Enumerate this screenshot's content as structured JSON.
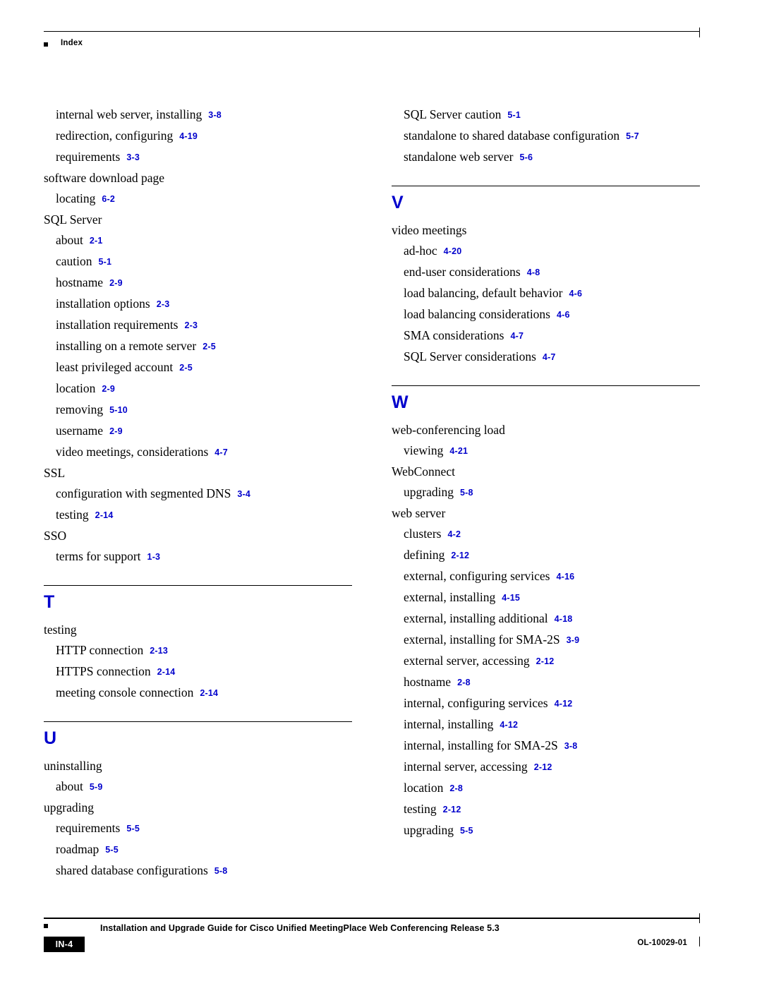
{
  "header": {
    "title": "Index"
  },
  "footer": {
    "page_label": "IN-4",
    "title": "Installation and Upgrade Guide for Cisco Unified MeetingPlace Web Conferencing Release 5.3",
    "doc_id": "OL-10029-01"
  },
  "colors": {
    "page_ref": "#0000cc",
    "letter_heading": "#0000cc",
    "text": "#000000",
    "background": "#ffffff"
  },
  "left_column": [
    {
      "kind": "entry",
      "level": 2,
      "text": "internal web server, installing",
      "page": "3-8"
    },
    {
      "kind": "entry",
      "level": 2,
      "text": "redirection, configuring",
      "page": "4-19"
    },
    {
      "kind": "entry",
      "level": 2,
      "text": "requirements",
      "page": "3-3"
    },
    {
      "kind": "entry",
      "level": 1,
      "text": "software download page",
      "page": ""
    },
    {
      "kind": "entry",
      "level": 2,
      "text": "locating",
      "page": "6-2"
    },
    {
      "kind": "entry",
      "level": 1,
      "text": "SQL Server",
      "page": ""
    },
    {
      "kind": "entry",
      "level": 2,
      "text": "about",
      "page": "2-1"
    },
    {
      "kind": "entry",
      "level": 2,
      "text": "caution",
      "page": "5-1"
    },
    {
      "kind": "entry",
      "level": 2,
      "text": "hostname",
      "page": "2-9"
    },
    {
      "kind": "entry",
      "level": 2,
      "text": "installation options",
      "page": "2-3"
    },
    {
      "kind": "entry",
      "level": 2,
      "text": "installation requirements",
      "page": "2-3"
    },
    {
      "kind": "entry",
      "level": 2,
      "text": "installing on a remote server",
      "page": "2-5"
    },
    {
      "kind": "entry",
      "level": 2,
      "text": "least privileged account",
      "page": "2-5"
    },
    {
      "kind": "entry",
      "level": 2,
      "text": "location",
      "page": "2-9"
    },
    {
      "kind": "entry",
      "level": 2,
      "text": "removing",
      "page": "5-10"
    },
    {
      "kind": "entry",
      "level": 2,
      "text": "username",
      "page": "2-9"
    },
    {
      "kind": "entry",
      "level": 2,
      "text": "video meetings, considerations",
      "page": "4-7"
    },
    {
      "kind": "entry",
      "level": 1,
      "text": "SSL",
      "page": ""
    },
    {
      "kind": "entry",
      "level": 2,
      "text": "configuration with segmented DNS",
      "page": "3-4"
    },
    {
      "kind": "entry",
      "level": 2,
      "text": "testing",
      "page": "2-14"
    },
    {
      "kind": "entry",
      "level": 1,
      "text": "SSO",
      "page": ""
    },
    {
      "kind": "entry",
      "level": 2,
      "text": "terms for support",
      "page": "1-3"
    },
    {
      "kind": "letter",
      "letter": "T"
    },
    {
      "kind": "entry",
      "level": 1,
      "text": "testing",
      "page": ""
    },
    {
      "kind": "entry",
      "level": 2,
      "text": "HTTP connection",
      "page": "2-13"
    },
    {
      "kind": "entry",
      "level": 2,
      "text": "HTTPS connection",
      "page": "2-14"
    },
    {
      "kind": "entry",
      "level": 2,
      "text": "meeting console connection",
      "page": "2-14"
    },
    {
      "kind": "letter",
      "letter": "U"
    },
    {
      "kind": "entry",
      "level": 1,
      "text": "uninstalling",
      "page": ""
    },
    {
      "kind": "entry",
      "level": 2,
      "text": "about",
      "page": "5-9"
    },
    {
      "kind": "entry",
      "level": 1,
      "text": "upgrading",
      "page": ""
    },
    {
      "kind": "entry",
      "level": 2,
      "text": "requirements",
      "page": "5-5"
    },
    {
      "kind": "entry",
      "level": 2,
      "text": "roadmap",
      "page": "5-5"
    },
    {
      "kind": "entry",
      "level": 2,
      "text": "shared database configurations",
      "page": "5-8"
    }
  ],
  "right_column": [
    {
      "kind": "entry",
      "level": 2,
      "text": "SQL Server caution",
      "page": "5-1"
    },
    {
      "kind": "entry",
      "level": 2,
      "text": "standalone to shared database configuration",
      "page": "5-7"
    },
    {
      "kind": "entry",
      "level": 2,
      "text": "standalone web server",
      "page": "5-6"
    },
    {
      "kind": "letter",
      "letter": "V"
    },
    {
      "kind": "entry",
      "level": 1,
      "text": "video meetings",
      "page": ""
    },
    {
      "kind": "entry",
      "level": 2,
      "text": "ad-hoc",
      "page": "4-20"
    },
    {
      "kind": "entry",
      "level": 2,
      "text": "end-user considerations",
      "page": "4-8"
    },
    {
      "kind": "entry",
      "level": 2,
      "text": "load balancing, default behavior",
      "page": "4-6"
    },
    {
      "kind": "entry",
      "level": 2,
      "text": "load balancing considerations",
      "page": "4-6"
    },
    {
      "kind": "entry",
      "level": 2,
      "text": "SMA considerations",
      "page": "4-7"
    },
    {
      "kind": "entry",
      "level": 2,
      "text": "SQL Server considerations",
      "page": "4-7"
    },
    {
      "kind": "letter",
      "letter": "W"
    },
    {
      "kind": "entry",
      "level": 1,
      "text": "web-conferencing load",
      "page": ""
    },
    {
      "kind": "entry",
      "level": 2,
      "text": "viewing",
      "page": "4-21"
    },
    {
      "kind": "entry",
      "level": 1,
      "text": "WebConnect",
      "page": ""
    },
    {
      "kind": "entry",
      "level": 2,
      "text": "upgrading",
      "page": "5-8"
    },
    {
      "kind": "entry",
      "level": 1,
      "text": "web server",
      "page": ""
    },
    {
      "kind": "entry",
      "level": 2,
      "text": "clusters",
      "page": "4-2"
    },
    {
      "kind": "entry",
      "level": 2,
      "text": "defining",
      "page": "2-12"
    },
    {
      "kind": "entry",
      "level": 2,
      "text": "external, configuring services",
      "page": "4-16"
    },
    {
      "kind": "entry",
      "level": 2,
      "text": "external, installing",
      "page": "4-15"
    },
    {
      "kind": "entry",
      "level": 2,
      "text": "external, installing additional",
      "page": "4-18"
    },
    {
      "kind": "entry",
      "level": 2,
      "text": "external, installing for SMA-2S",
      "page": "3-9"
    },
    {
      "kind": "entry",
      "level": 2,
      "text": "external server, accessing",
      "page": "2-12"
    },
    {
      "kind": "entry",
      "level": 2,
      "text": "hostname",
      "page": "2-8"
    },
    {
      "kind": "entry",
      "level": 2,
      "text": "internal, configuring services",
      "page": "4-12"
    },
    {
      "kind": "entry",
      "level": 2,
      "text": "internal, installing",
      "page": "4-12"
    },
    {
      "kind": "entry",
      "level": 2,
      "text": "internal, installing for SMA-2S",
      "page": "3-8"
    },
    {
      "kind": "entry",
      "level": 2,
      "text": "internal server, accessing",
      "page": "2-12"
    },
    {
      "kind": "entry",
      "level": 2,
      "text": "location",
      "page": "2-8"
    },
    {
      "kind": "entry",
      "level": 2,
      "text": "testing",
      "page": "2-12"
    },
    {
      "kind": "entry",
      "level": 2,
      "text": "upgrading",
      "page": "5-5"
    }
  ]
}
